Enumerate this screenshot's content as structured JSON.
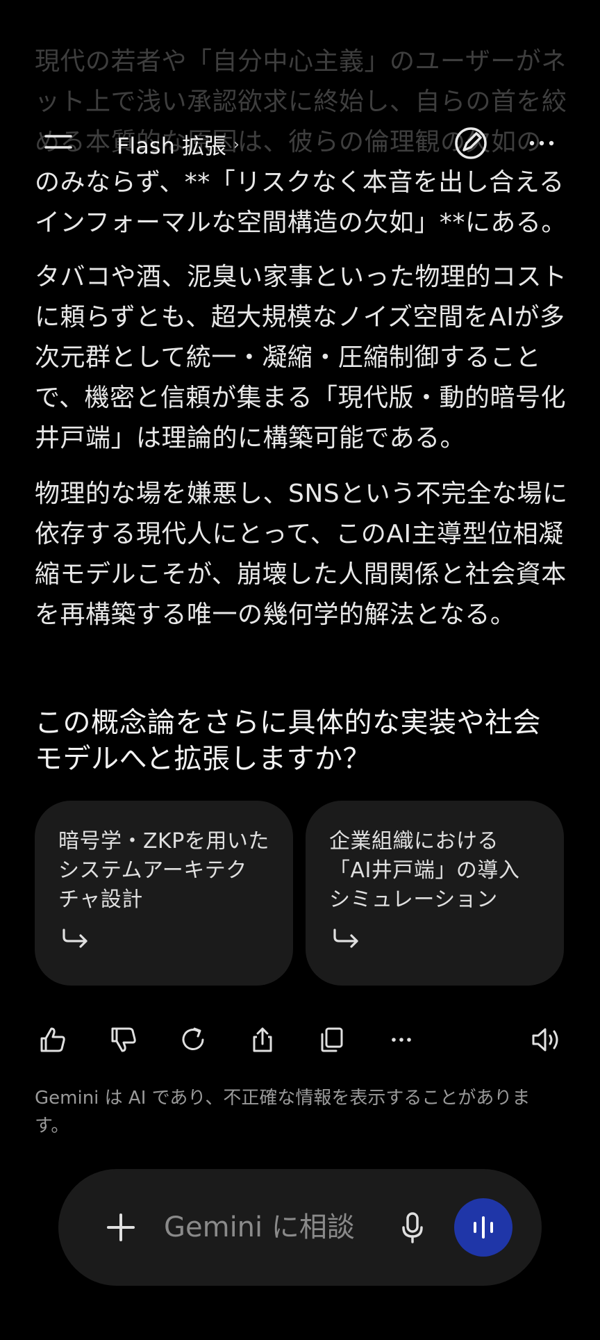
{
  "header": {
    "title": "Flash 拡張",
    "chevron": "›"
  },
  "message": {
    "p1_faded_line1": "現代の若者や「自分中心主義」のユーザーがネ",
    "p1_faded_line2": "ット上で浅い承認欲求に終始し、自らの首を絞",
    "p1_faded_line3": "める本質的な原因は、彼らの倫理観の欠如の",
    "p1_line4": "のみならず、**「リスクなく本音を出し合える",
    "p1_line5": "インフォーマルな空間構造の欠如」**にある。",
    "p2_line1": "タバコや酒、泥臭い家事といった物理的コスト",
    "p2_line2": "に頼らずとも、超大規模なノイズ空間をAIが多",
    "p2_line3": "次元群として統一・凝縮・圧縮制御すること",
    "p2_line4": "で、機密と信頼が集まる「現代版・動的暗号化",
    "p2_line5": "井戸端」は理論的に構築可能である。",
    "p3_line1": "物理的な場を嫌悪し、SNSという不完全な場に",
    "p3_line2": "依存する現代人にとって、このAI主導型位相凝",
    "p3_line3": "縮モデルこそが、崩壊した人間関係と社会資本",
    "p3_line4": "を再構築する唯一の幾何学的解法となる。"
  },
  "followup": {
    "question_line1": "この概念論をさらに具体的な実装や社会",
    "question_line2": "モデルへと拡張しますか？",
    "cards": [
      {
        "line1": "暗号学・ZKPを用いた",
        "line2": "システムアーキテク",
        "line3": "チャ設計"
      },
      {
        "line1": "企業組織における",
        "line2": "「AI井戸端」の導入",
        "line3": "シミュレーション"
      }
    ]
  },
  "actions": {
    "icons": [
      "thumbs-up-icon",
      "thumbs-down-icon",
      "redo-icon",
      "share-icon",
      "copy-icon",
      "more-icon",
      "speaker-icon"
    ]
  },
  "disclaimer": {
    "line1": "Gemini は AI であり、不正確な情報を表示することがありま",
    "line2": "す。"
  },
  "input": {
    "placeholder": "Gemini に相談"
  },
  "colors": {
    "background": "#000000",
    "card": "#1b1b1b",
    "voice_button": "#1f36a8"
  }
}
